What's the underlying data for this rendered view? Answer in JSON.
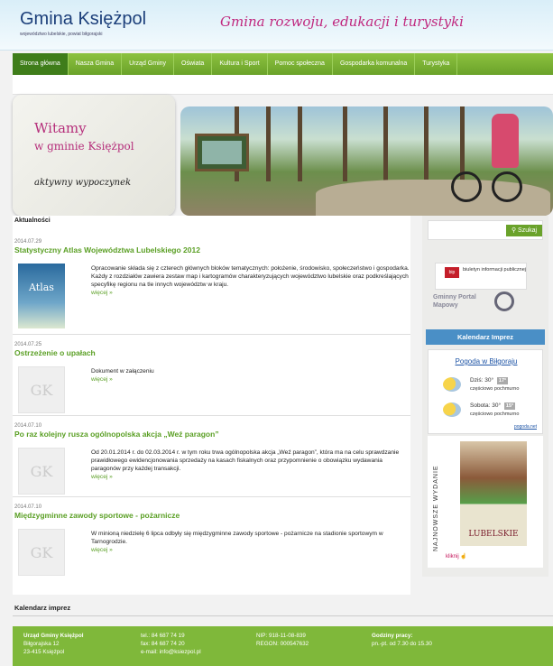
{
  "header": {
    "site_title": "Gmina Księżpol",
    "subtitle": "województwo lubelskie, powiat biłgorajski",
    "slogan": "Gmina rozwoju, edukacji i turystyki"
  },
  "nav": {
    "items": [
      {
        "label": "Strona główna",
        "active": true
      },
      {
        "label": "Nasza Gmina"
      },
      {
        "label": "Urząd Gminy"
      },
      {
        "label": "Oświata"
      },
      {
        "label": "Kultura i Sport"
      },
      {
        "label": "Pomoc społeczna"
      },
      {
        "label": "Gospodarka komunalna"
      },
      {
        "label": "Turystyka"
      }
    ]
  },
  "banner": {
    "welcome_line1": "Witamy",
    "welcome_line2": "w gminie Księżpol",
    "tagline": "aktywny wypoczynek"
  },
  "main": {
    "section_title": "Aktualności",
    "news": [
      {
        "date": "2014.07.29",
        "title": "Statystyczny Atlas Województwa Lubelskiego 2012",
        "body": "Opracowanie składa się z czterech głównych bloków tematycznych: położenie, środowisko, społeczeństwo i gospodarka. Każdy z rozdziałów zawiera zestaw map i kartogramów charakteryzujących województwo lubelskie oraz podkreślających specyfikę regionu na tle innych województw w kraju.",
        "more": "więcej »",
        "thumb": "Atlas"
      },
      {
        "date": "2014.07.25",
        "title": "Ostrzeżenie o upałach",
        "body": "Dokument w załączeniu",
        "more": "więcej »",
        "thumb": "GK"
      },
      {
        "date": "2014.07.10",
        "title": "Po raz kolejny rusza ogólnopolska akcja „Weź paragon”",
        "body": "Od 20.01.2014 r. do 02.03.2014 r. w tym roku trwa ogólnopolska akcja „Weź paragon”, która ma na celu sprawdzanie prawidłowego ewidencjonowania sprzedaży na kasach fiskalnych oraz przypomnienie o obowiązku wydawania paragonów przy każdej transakcji.",
        "more": "więcej »",
        "thumb": "GK"
      },
      {
        "date": "2014.07.10",
        "title": "Międzygminne zawody sportowe - pożarnicze",
        "body": "W minioną niedzielę 6 lipca odbyły się międzygminne zawody sportowe - pożarnicze na stadionie sportowym w Tarnogrodzie.",
        "more": "więcej »",
        "thumb": "GK"
      }
    ],
    "calendar_title": "Kalendarz imprez"
  },
  "sidebar": {
    "search_label": "Szukaj",
    "bip_badge": "bip",
    "bip_text": "biuletyn informacji publicznej",
    "portal_text": "Gminny Portal Mapowy",
    "calendar_button": "Kalendarz Imprez",
    "weather": {
      "title": "Pogoda w Biłgoraju",
      "today_label": "Dziś:",
      "today_temp": "30°",
      "today_badge": "17°",
      "today_desc": "częściowo pochmurno",
      "sat_label": "Sobota:",
      "sat_temp": "30°",
      "sat_badge": "15°",
      "sat_desc": "częściowo pochmurno",
      "source": "pogoda.net"
    },
    "promo_vertical": "NAJNOWSZE WYDANIE",
    "promo_cover": "LUBELSKIE",
    "promo_click": "kliknij"
  },
  "footer": {
    "col1": {
      "name": "Urząd Gminy Księżpol",
      "street": "Biłgorajska 12",
      "city": "23-415 Księżpol"
    },
    "col2": {
      "tel": "tel.: 84 687 74 19",
      "fax": "fax: 84 687 74 20",
      "email": "e-mail: info@ksiezpol.pl"
    },
    "col3": {
      "nip": "NIP: 918-11-08-839",
      "regon": "REGON: 000547632"
    },
    "col4": {
      "title": "Godziny pracy:",
      "hours": "pn.-pt. od 7.30 do 15.30"
    }
  },
  "colors": {
    "nav_green": "#6aa22a",
    "active_nav": "#3f7d1a",
    "title_blue": "#1c3f7a",
    "accent_magenta": "#c0277e",
    "link_green": "#5a9f24",
    "footer_green": "#7fb83a"
  }
}
